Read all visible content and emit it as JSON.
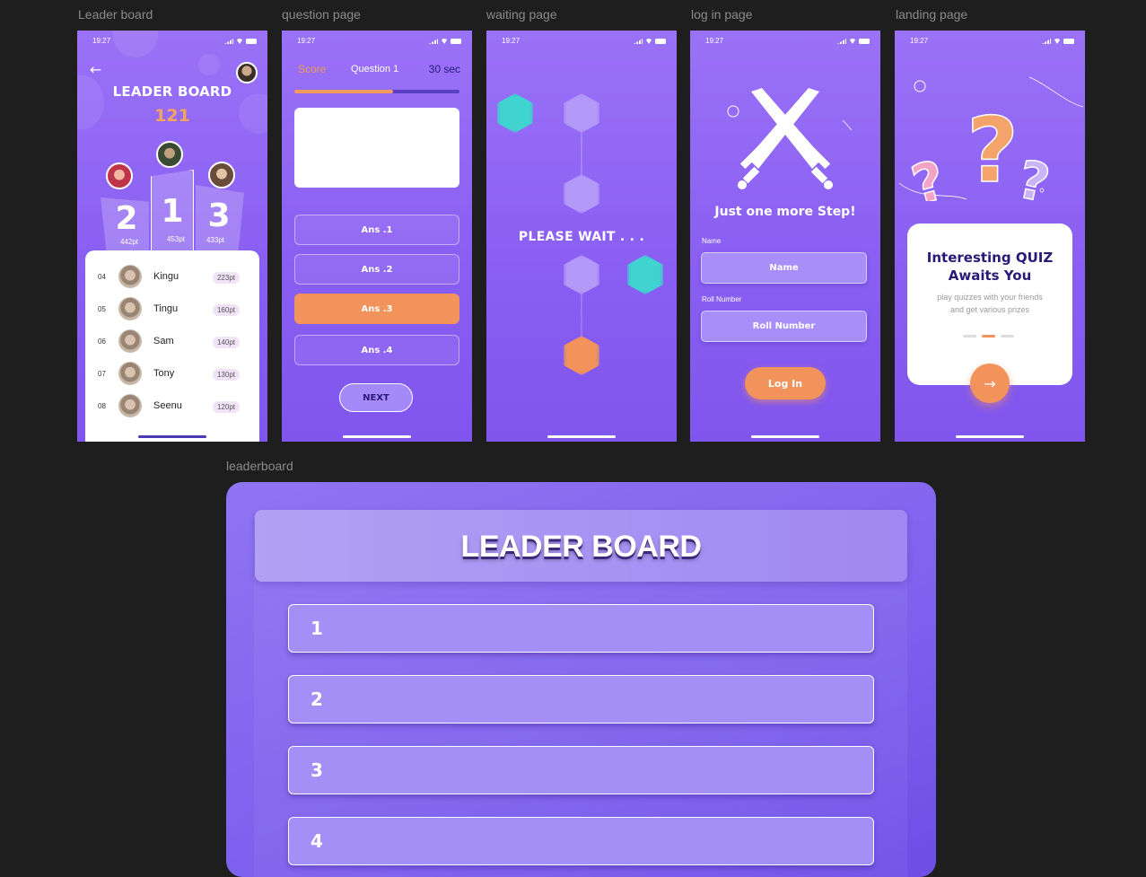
{
  "frames": {
    "leaderboard_mobile": "Leader board",
    "question": "question page",
    "waiting": "waiting page",
    "login": "log in page",
    "landing": "landing page",
    "leaderboard_web": "leaderboard"
  },
  "status": {
    "time": "19:27"
  },
  "leaderboard": {
    "title": "LEADER BOARD",
    "score": "121",
    "podium": [
      {
        "rank": "2",
        "points": "442pt"
      },
      {
        "rank": "1",
        "points": "453pt"
      },
      {
        "rank": "3",
        "points": "433pt"
      }
    ],
    "rows": [
      {
        "rank": "04",
        "name": "Kingu",
        "points": "223pt"
      },
      {
        "rank": "05",
        "name": "Tingu",
        "points": "160pt"
      },
      {
        "rank": "06",
        "name": "Sam",
        "points": "140pt"
      },
      {
        "rank": "07",
        "name": "Tony",
        "points": "130pt"
      },
      {
        "rank": "08",
        "name": "Seenu",
        "points": "120pt"
      }
    ]
  },
  "question": {
    "score_label": "Score",
    "question_label": "Question 1",
    "timer": "30 sec",
    "progress": 0.6,
    "answers": [
      "Ans .1",
      "Ans .2",
      "Ans .3",
      "Ans .4"
    ],
    "selected_answer": "Ans .3",
    "next": "NEXT"
  },
  "waiting": {
    "message": "PLEASE WAIT . . ."
  },
  "login": {
    "headline": "Just one more Step!",
    "name_label": "Name",
    "name_placeholder": "Name",
    "roll_label": "Roll Number",
    "roll_placeholder": "Roll  Number",
    "button": "Log In"
  },
  "landing": {
    "title_line1": "Interesting QUIZ",
    "title_line2": "Awaits You",
    "subtitle_line1": "play quizzes with your friends",
    "subtitle_line2": "and get various prizes",
    "arrow_icon": "arrow-right-icon"
  },
  "board": {
    "title": "LEADER BOARD",
    "rows": [
      "1",
      "2",
      "3",
      "4"
    ]
  },
  "colors": {
    "accent": "#f2935c",
    "purple": "#8a5ff2",
    "dark": "#1e1e1e"
  }
}
